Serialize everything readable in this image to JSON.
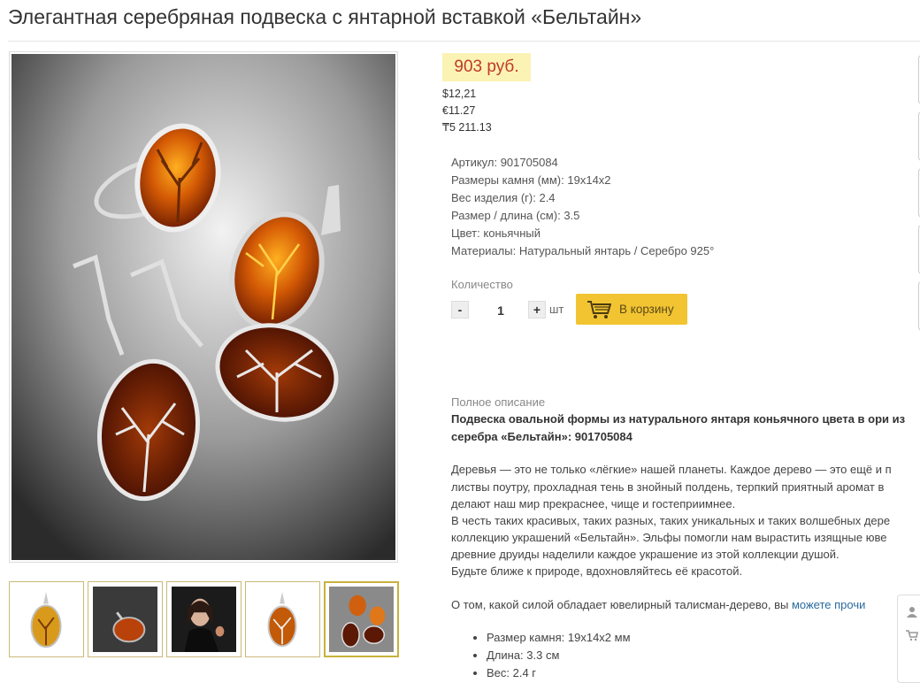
{
  "product": {
    "title": "Элегантная серебряная подвеска с янтарной вставкой «Бельтайн»",
    "price": "903 руб.",
    "price_usd": "$12,21",
    "price_eur": "€11.27",
    "price_kzt": "₸5 211.13"
  },
  "specs": [
    {
      "label": "Артикул:",
      "value": "901705084"
    },
    {
      "label": "Размеры камня (мм):",
      "value": "19х14х2"
    },
    {
      "label": "Вес изделия (г):",
      "value": "2.4"
    },
    {
      "label": "Размер / длина (см):",
      "value": "3.5"
    },
    {
      "label": "Цвет:",
      "value": "коньячный"
    },
    {
      "label": "Материалы:",
      "value": "Натуральный янтарь / Серебро 925°"
    }
  ],
  "quantity": {
    "label": "Количество",
    "minus": "-",
    "plus": "+",
    "value": "1",
    "unit": "шт"
  },
  "cart_button": {
    "label": "В корзину",
    "icon": "cart-icon",
    "color": "#f2c431"
  },
  "description": {
    "label": "Полное описание",
    "heading": "Подвеска овальной формы из натурального янтаря коньячного цвета в ори из серебра «Бельтайн»: 901705084",
    "lines": [
      "Деревья — это не только «лёгкие» нашей планеты. Каждое дерево — это ещё и п",
      "листвы поутру, прохладная тень в знойный полдень, терпкий приятный аромат в",
      "делают наш мир прекраснее, чище и гостеприимнее.",
      "В честь таких красивых, таких разных, таких уникальных и таких волшебных дере",
      "коллекцию украшений «Бельтайн». Эльфы помогли нам вырастить изящные юве",
      "древние друиды наделили каждое украшение из этой коллекции душой.",
      "Будьте ближе к природе, вдохновляйтесь её красотой."
    ],
    "talisman_text": "О том, какой силой обладает ювелирный талисман-дерево, вы ",
    "talisman_link": "можете прочи",
    "bullets": [
      "Размер камня: 19х14х2 мм",
      "Длина: 3.3 см",
      "Вес: 2.4 г"
    ]
  },
  "thumbnails": [
    {
      "name": "amber-pendant-front",
      "selected": false
    },
    {
      "name": "amber-pendant-dark",
      "selected": false
    },
    {
      "name": "model-wearing-jewelry",
      "selected": false
    },
    {
      "name": "amber-pendant-tree",
      "selected": false
    },
    {
      "name": "jewelry-set",
      "selected": true
    }
  ],
  "side_panel": {
    "icons": [
      "user-icon",
      "cart-icon"
    ]
  },
  "colors": {
    "price_bg": "#fbf3b3",
    "price_text": "#c0392b",
    "accent": "#f2c431",
    "link": "#2a6a9e"
  }
}
